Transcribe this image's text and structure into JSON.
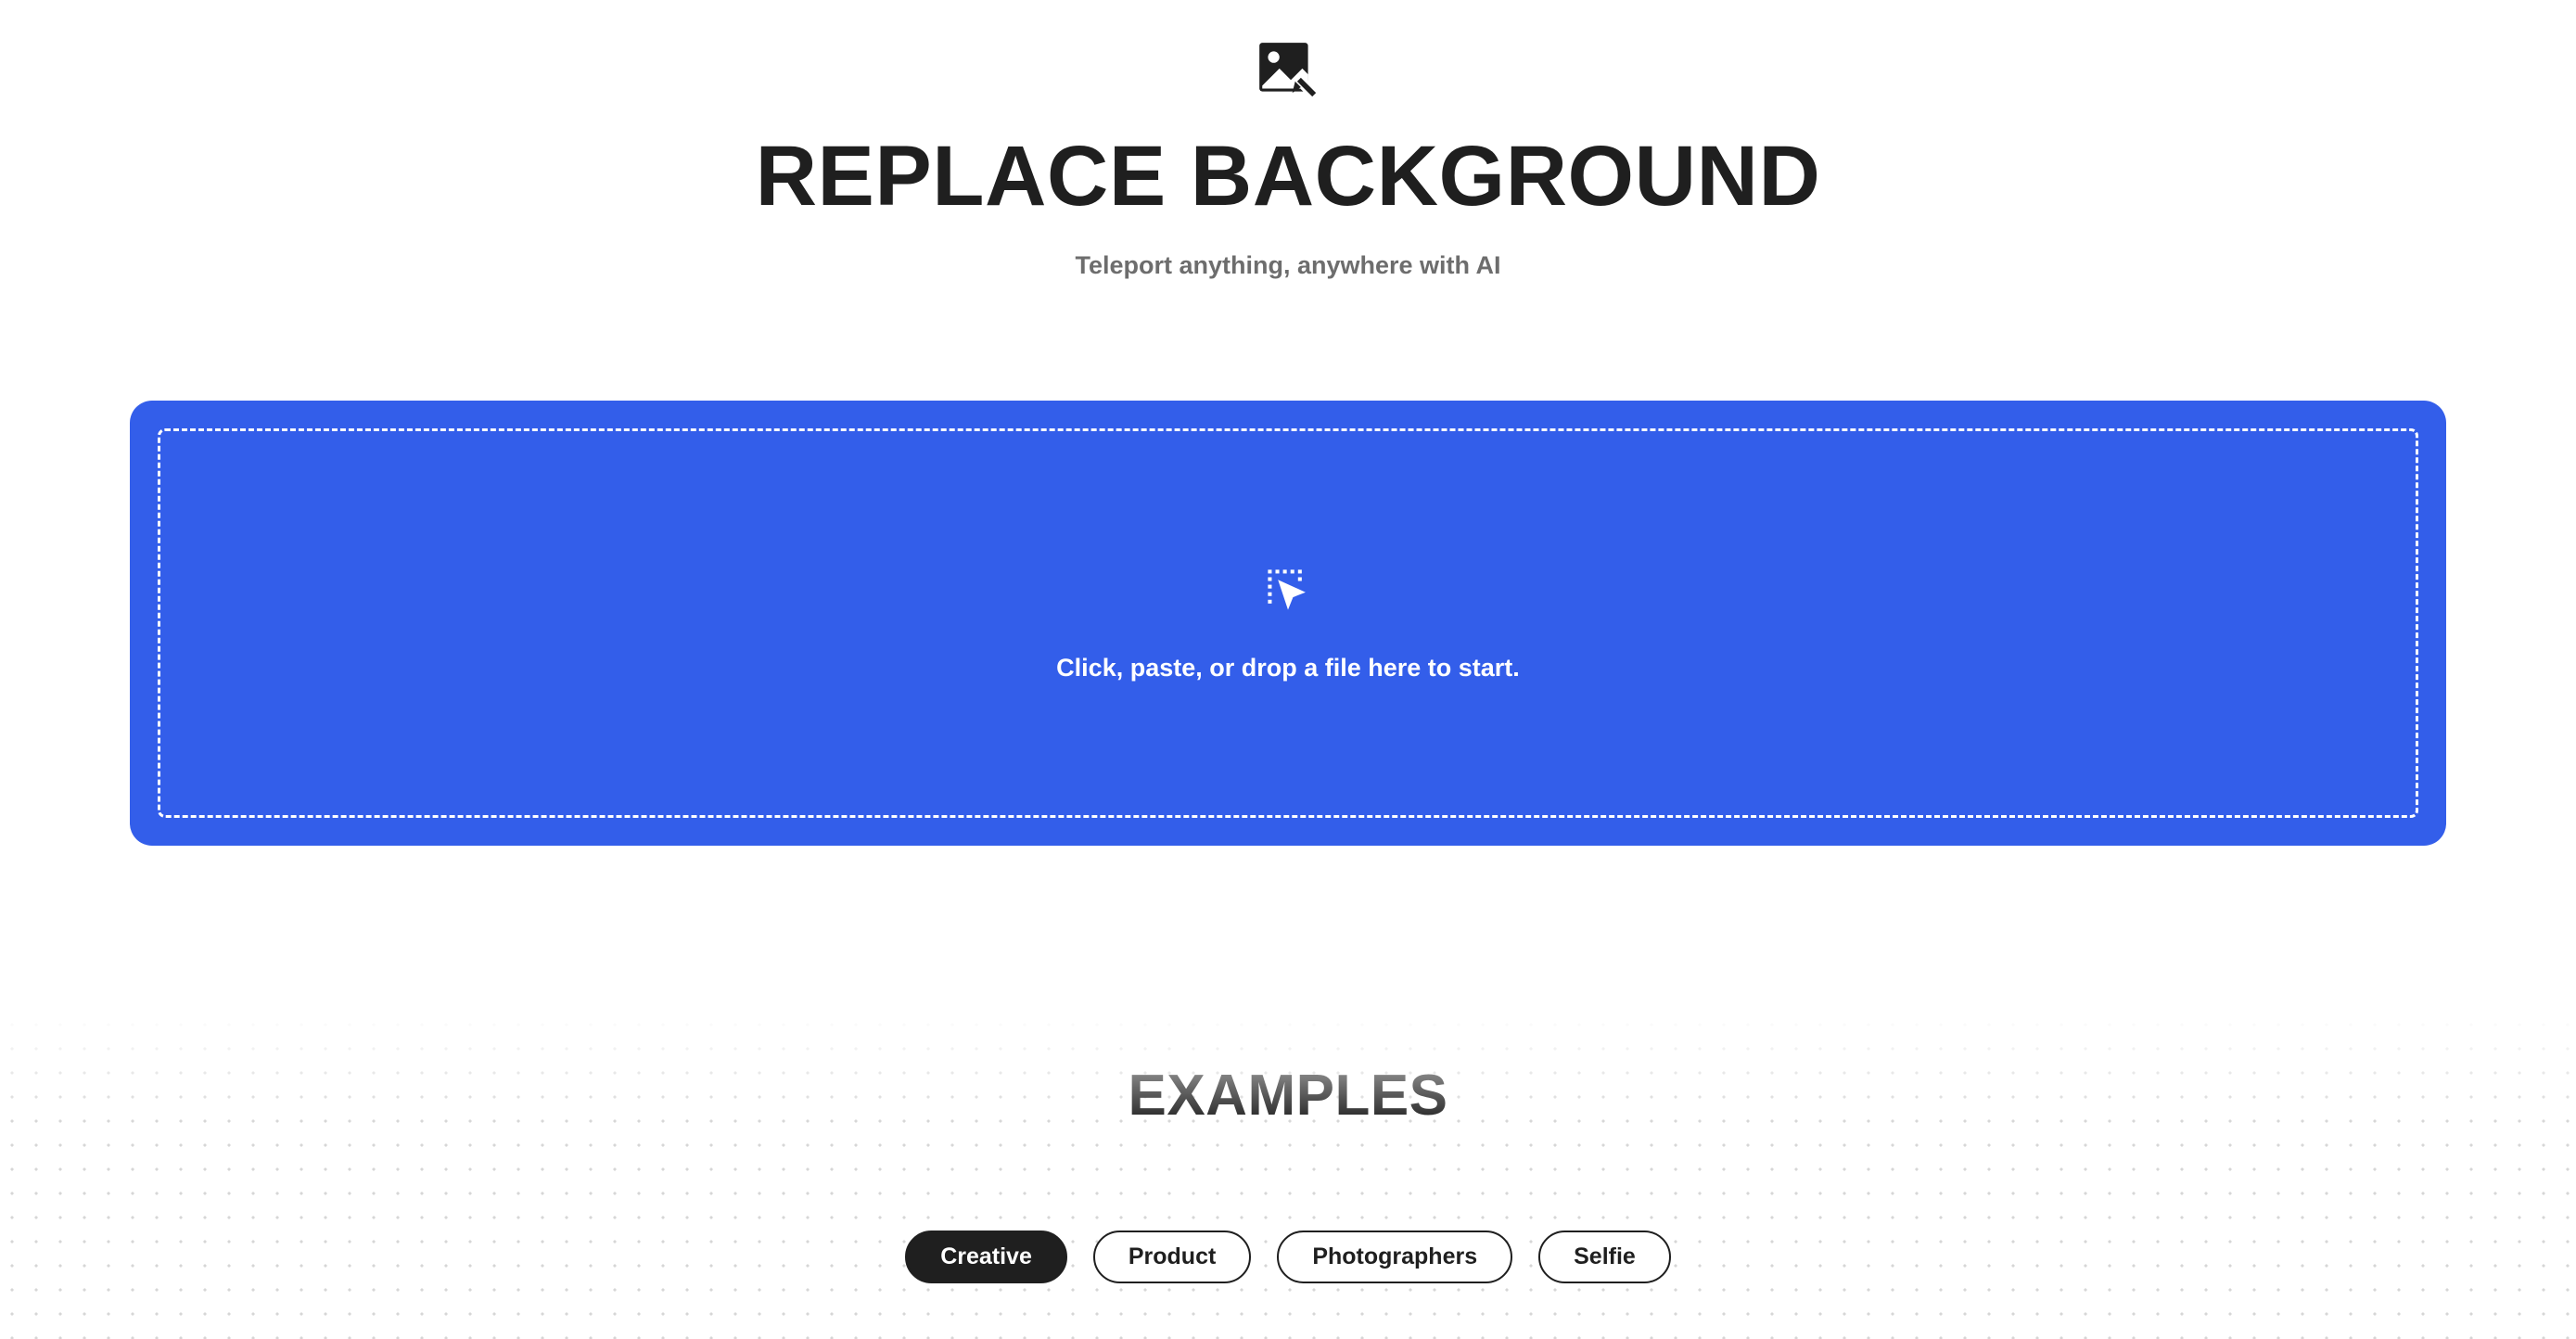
{
  "hero": {
    "title": "REPLACE BACKGROUND",
    "subtitle": "Teleport anything, anywhere with AI"
  },
  "dropzone": {
    "prompt": "Click, paste, or drop a file here to start."
  },
  "examples": {
    "title": "EXAMPLES",
    "tabs": [
      {
        "label": "Creative",
        "active": true
      },
      {
        "label": "Product",
        "active": false
      },
      {
        "label": "Photographers",
        "active": false
      },
      {
        "label": "Selfie",
        "active": false
      }
    ]
  },
  "colors": {
    "accent": "#335eea",
    "text": "#1f1f1f",
    "muted": "#6d6d6d"
  }
}
